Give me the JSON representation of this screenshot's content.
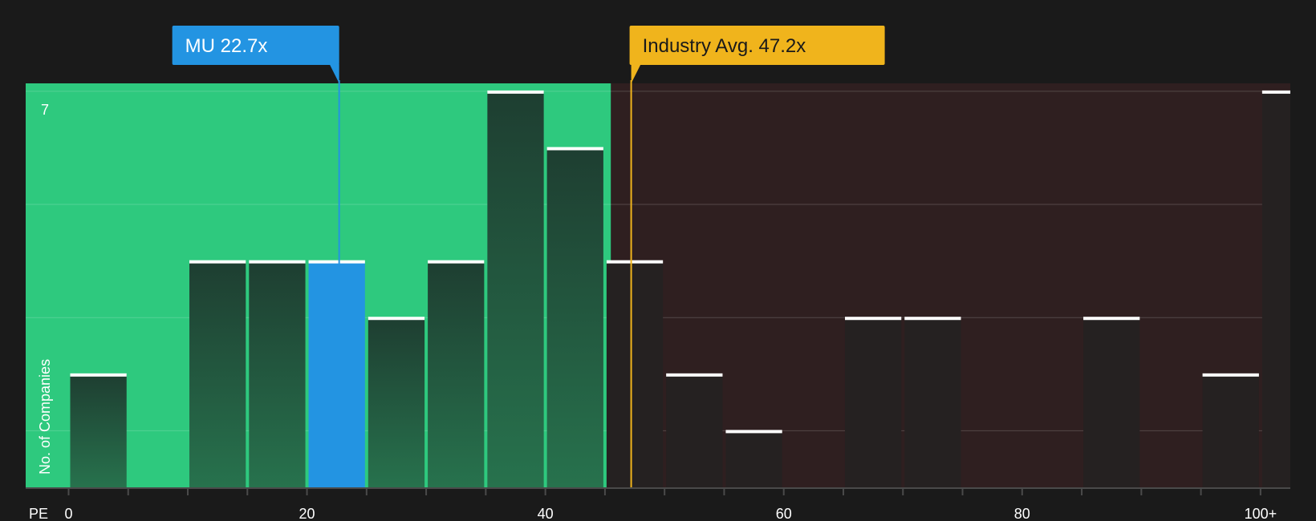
{
  "chart_data": {
    "type": "bar",
    "title": "",
    "xlabel": "PE",
    "ylabel": "No. of Companies",
    "x_tick_labels": [
      {
        "value": 0,
        "label": "0"
      },
      {
        "value": 20,
        "label": "20"
      },
      {
        "value": 40,
        "label": "40"
      },
      {
        "value": 60,
        "label": "60"
      },
      {
        "value": 80,
        "label": "80"
      },
      {
        "value": 100,
        "label": "100+"
      }
    ],
    "xlim": [
      -3.6,
      102.5
    ],
    "ylim": [
      0,
      7.14
    ],
    "y_tick_labels": [
      {
        "value": 7,
        "label": "7"
      }
    ],
    "grid": true,
    "bin_width": 5,
    "bins": [
      {
        "start": 0,
        "count": 2
      },
      {
        "start": 5,
        "count": 0
      },
      {
        "start": 10,
        "count": 4
      },
      {
        "start": 15,
        "count": 4
      },
      {
        "start": 20,
        "count": 4,
        "highlight": true
      },
      {
        "start": 25,
        "count": 3
      },
      {
        "start": 30,
        "count": 4
      },
      {
        "start": 35,
        "count": 7
      },
      {
        "start": 40,
        "count": 6
      },
      {
        "start": 45,
        "count": 4
      },
      {
        "start": 50,
        "count": 2
      },
      {
        "start": 55,
        "count": 1
      },
      {
        "start": 60,
        "count": 0
      },
      {
        "start": 65,
        "count": 3
      },
      {
        "start": 70,
        "count": 3
      },
      {
        "start": 75,
        "count": 0
      },
      {
        "start": 80,
        "count": 0
      },
      {
        "start": 85,
        "count": 3
      },
      {
        "start": 90,
        "count": 0
      },
      {
        "start": 95,
        "count": 2
      },
      {
        "start": 100,
        "count": 7
      }
    ],
    "regions": [
      {
        "name": "below-average",
        "from": -3.6,
        "to": 45.5,
        "color": "#2ec97e"
      },
      {
        "name": "above-average",
        "from": 45.5,
        "to": 102.5,
        "color": "#2f1f20"
      }
    ],
    "markers": [
      {
        "id": "company",
        "label": "MU 22.7x",
        "value": 22.7,
        "color": "#2394e2",
        "text_color": "#ffffff"
      },
      {
        "id": "industry",
        "label": "Industry Avg. 47.2x",
        "value": 47.2,
        "color": "#f0b41c",
        "text_color": "#1a1a1a"
      }
    ]
  },
  "colors": {
    "background": "#1a1a1a",
    "bar_in_green": "#214937",
    "bar_in_dark": "#252121",
    "bar_highlight": "#2394e2",
    "bar_top": "#ffffff",
    "axis": "#4a4a4a"
  }
}
